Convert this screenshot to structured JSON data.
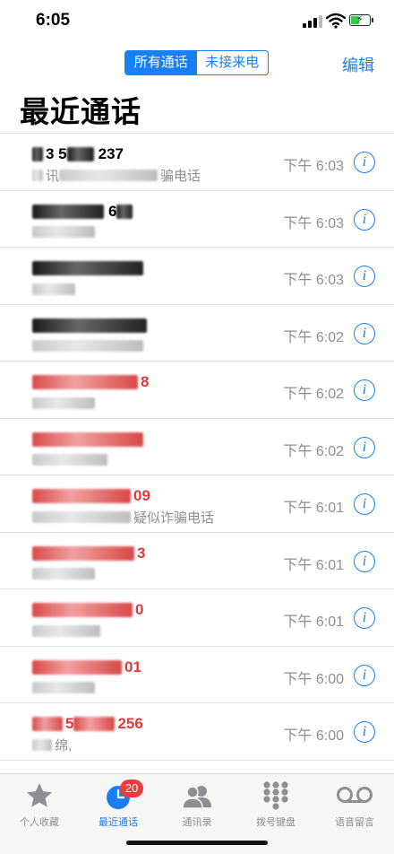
{
  "status": {
    "time": "6:05"
  },
  "header": {
    "segments": [
      {
        "label": "所有通话"
      },
      {
        "label": "未接来电"
      }
    ],
    "edit_label": "编辑",
    "title": "最近通话"
  },
  "calls": [
    {
      "number_visible": "3 5",
      "number_tail": "237",
      "label_visible": "讯",
      "label_tail": "骗电话",
      "time": "下午 6:03",
      "missed": false
    },
    {
      "number_visible": "",
      "number_tail": "6",
      "label_visible": "",
      "label_tail": "",
      "time": "下午 6:03",
      "missed": false
    },
    {
      "number_visible": "",
      "number_tail": "",
      "label_visible": "",
      "label_tail": "",
      "time": "下午 6:03",
      "missed": false
    },
    {
      "number_visible": "",
      "number_tail": "",
      "label_visible": "",
      "label_tail": "",
      "time": "下午 6:02",
      "missed": false
    },
    {
      "number_visible": "",
      "number_tail": "8",
      "label_visible": "",
      "label_tail": "",
      "time": "下午 6:02",
      "missed": true
    },
    {
      "number_visible": "",
      "number_tail": "",
      "label_visible": "",
      "label_tail": "",
      "time": "下午 6:02",
      "missed": true
    },
    {
      "number_visible": "",
      "number_tail": "09",
      "label_visible": "",
      "label_tail": "疑似诈骗电话",
      "time": "下午 6:01",
      "missed": true
    },
    {
      "number_visible": "",
      "number_tail": "3",
      "label_visible": "",
      "label_tail": "",
      "time": "下午 6:01",
      "missed": true
    },
    {
      "number_visible": "",
      "number_tail": "0",
      "label_visible": "",
      "label_tail": "",
      "time": "下午 6:01",
      "missed": true
    },
    {
      "number_visible": "",
      "number_tail": "01",
      "label_visible": "",
      "label_tail": "",
      "time": "下午 6:00",
      "missed": true
    },
    {
      "number_visible": "5",
      "number_tail": "256",
      "label_visible": "",
      "label_tail": "绵,",
      "time": "下午 6:00",
      "missed": true
    }
  ],
  "info_glyph": "i",
  "tabs": [
    {
      "label": "个人收藏",
      "icon": "star-icon"
    },
    {
      "label": "最近通话",
      "icon": "clock-icon",
      "badge": "20"
    },
    {
      "label": "通讯录",
      "icon": "contacts-icon"
    },
    {
      "label": "拨号键盘",
      "icon": "keypad-icon"
    },
    {
      "label": "语音留言",
      "icon": "voicemail-icon"
    }
  ],
  "colors": {
    "accent": "#1a7ff5",
    "missed": "#e03a3a",
    "badge": "#f23b3b",
    "secondary": "#8e8e93"
  }
}
